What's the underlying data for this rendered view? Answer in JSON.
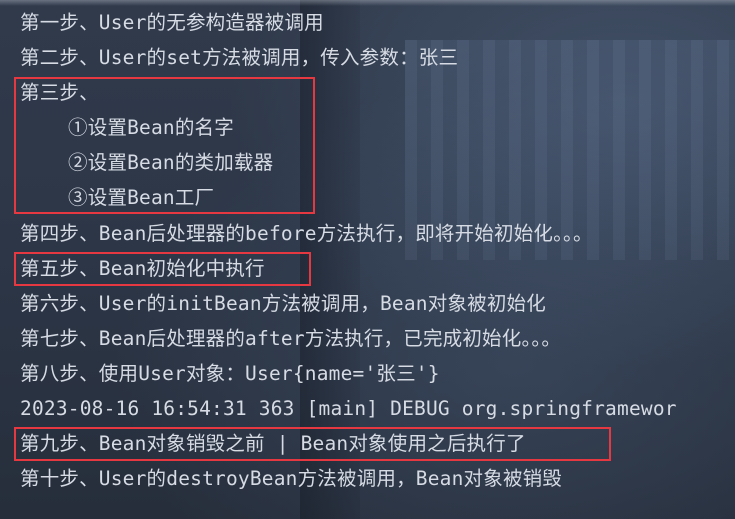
{
  "console": {
    "lines": [
      "第一步、User的无参构造器被调用",
      "第二步、User的set方法被调用，传入参数：张三",
      "第三步、",
      "①设置Bean的名字",
      "②设置Bean的类加载器",
      "③设置Bean工厂",
      "第四步、Bean后处理器的before方法执行，即将开始初始化。。。",
      "第五步、Bean初始化中执行",
      "第六步、User的initBean方法被调用，Bean对象被初始化",
      "第七步、Bean后处理器的after方法执行，已完成初始化。。。",
      "第八步、使用User对象：User{name='张三'}",
      "2023-08-16 16:54:31 363 [main] DEBUG org.springframewor",
      "第九步、Bean对象销毁之前 | Bean对象使用之后执行了",
      "第十步、User的destroyBean方法被调用，Bean对象被销毁"
    ]
  },
  "colors": {
    "text": "#d6dbe4",
    "highlight_border": "#e53840",
    "background": "#2b3444"
  }
}
